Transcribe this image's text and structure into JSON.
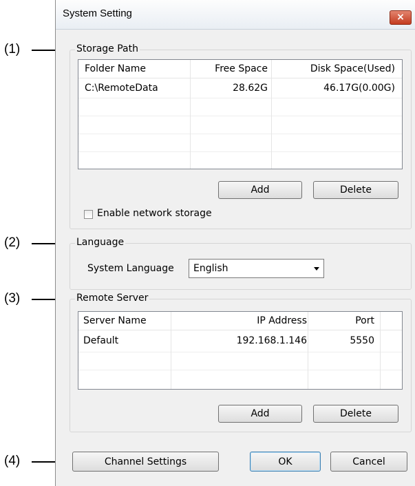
{
  "window": {
    "title": "System Setting",
    "close_glyph": "×"
  },
  "callouts": [
    "(1)",
    "(2)",
    "(3)",
    "(4)"
  ],
  "storage": {
    "group_label": "Storage Path",
    "columns": [
      "Folder Name",
      "Free Space",
      "Disk Space(Used)"
    ],
    "rows": [
      [
        "C:\\RemoteData",
        "28.62G",
        "46.17G(0.00G)"
      ]
    ],
    "add_label": "Add",
    "delete_label": "Delete",
    "network_storage_label": "Enable network storage",
    "network_storage_checked": false
  },
  "language": {
    "group_label": "Language",
    "field_label": "System Language",
    "selected": "English"
  },
  "remote": {
    "group_label": "Remote Server",
    "columns": [
      "Server Name",
      "IP Address",
      "Port"
    ],
    "rows": [
      [
        "Default",
        "192.168.1.146",
        "5550"
      ]
    ],
    "add_label": "Add",
    "delete_label": "Delete"
  },
  "footer": {
    "channel_settings_label": "Channel Settings",
    "ok_label": "OK",
    "cancel_label": "Cancel"
  }
}
